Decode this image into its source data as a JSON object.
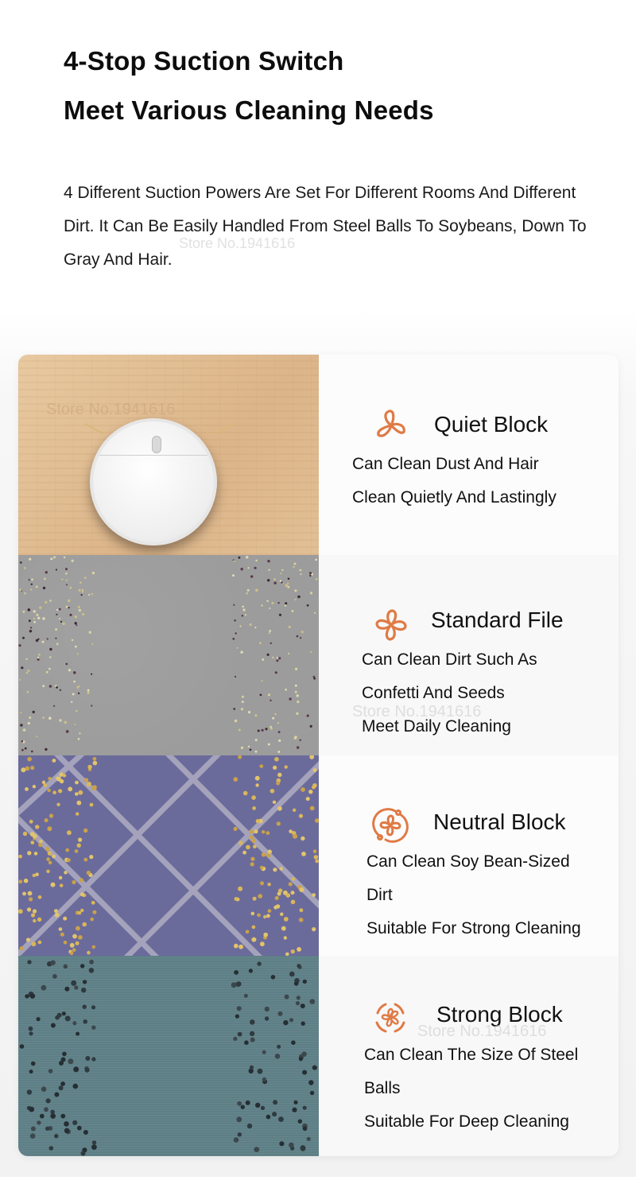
{
  "header": {
    "title_line1": "4-Stop Suction Switch",
    "title_line2": "Meet Various Cleaning Needs"
  },
  "intro": {
    "text": "4 Different Suction Powers Are Set For Different Rooms And Different Dirt. It Can Be Easily Handled From Steel Balls To Soybeans, Down To Gray And Hair."
  },
  "watermark": "Store No.1941616",
  "accent_color": "#e07a45",
  "modes": [
    {
      "icon": "fan-3-blade-icon",
      "title": "Quiet Block",
      "lines": [
        "Can Clean Dust And Hair",
        "Clean Quietly And Lastingly"
      ],
      "photo": "robot vacuum on wood floor"
    },
    {
      "icon": "fan-4-blade-icon",
      "title": "Standard File",
      "lines": [
        "Can Clean Dirt Such As",
        "Confetti And Seeds",
        "Meet Daily Cleaning"
      ],
      "photo": "seeds on grey concrete"
    },
    {
      "icon": "fan-circled-icon",
      "title": "Neutral Block",
      "lines": [
        "Can Clean Soy Bean-Sized",
        "Dirt",
        "Suitable For Strong Cleaning"
      ],
      "photo": "soybeans on purple carpet"
    },
    {
      "icon": "fan-turbo-icon",
      "title": "Strong Block",
      "lines": [
        "Can Clean The Size Of Steel",
        "Balls",
        "Suitable For Deep Cleaning"
      ],
      "photo": "steel balls on teal floor"
    }
  ]
}
